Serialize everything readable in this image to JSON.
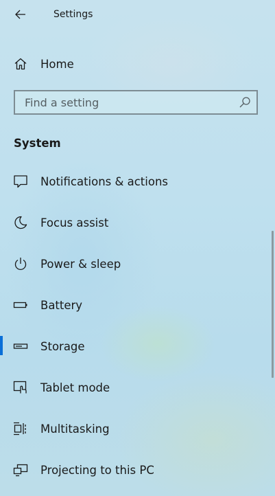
{
  "window": {
    "title": "Settings"
  },
  "home": {
    "label": "Home",
    "icon": "home-icon"
  },
  "search": {
    "placeholder": "Find a setting",
    "value": "",
    "icon": "search-icon"
  },
  "section": {
    "title": "System"
  },
  "nav_items": [
    {
      "label": "Notifications & actions",
      "icon": "notification-icon"
    },
    {
      "label": "Focus assist",
      "icon": "moon-icon"
    },
    {
      "label": "Power & sleep",
      "icon": "power-icon"
    },
    {
      "label": "Battery",
      "icon": "battery-icon"
    },
    {
      "label": "Storage",
      "icon": "storage-icon",
      "selected": true
    },
    {
      "label": "Tablet mode",
      "icon": "tablet-mode-icon"
    },
    {
      "label": "Multitasking",
      "icon": "multitasking-icon"
    },
    {
      "label": "Projecting to this PC",
      "icon": "projecting-icon"
    }
  ],
  "colors": {
    "accent": "#0a6fd8",
    "text": "#1a1a1a"
  }
}
